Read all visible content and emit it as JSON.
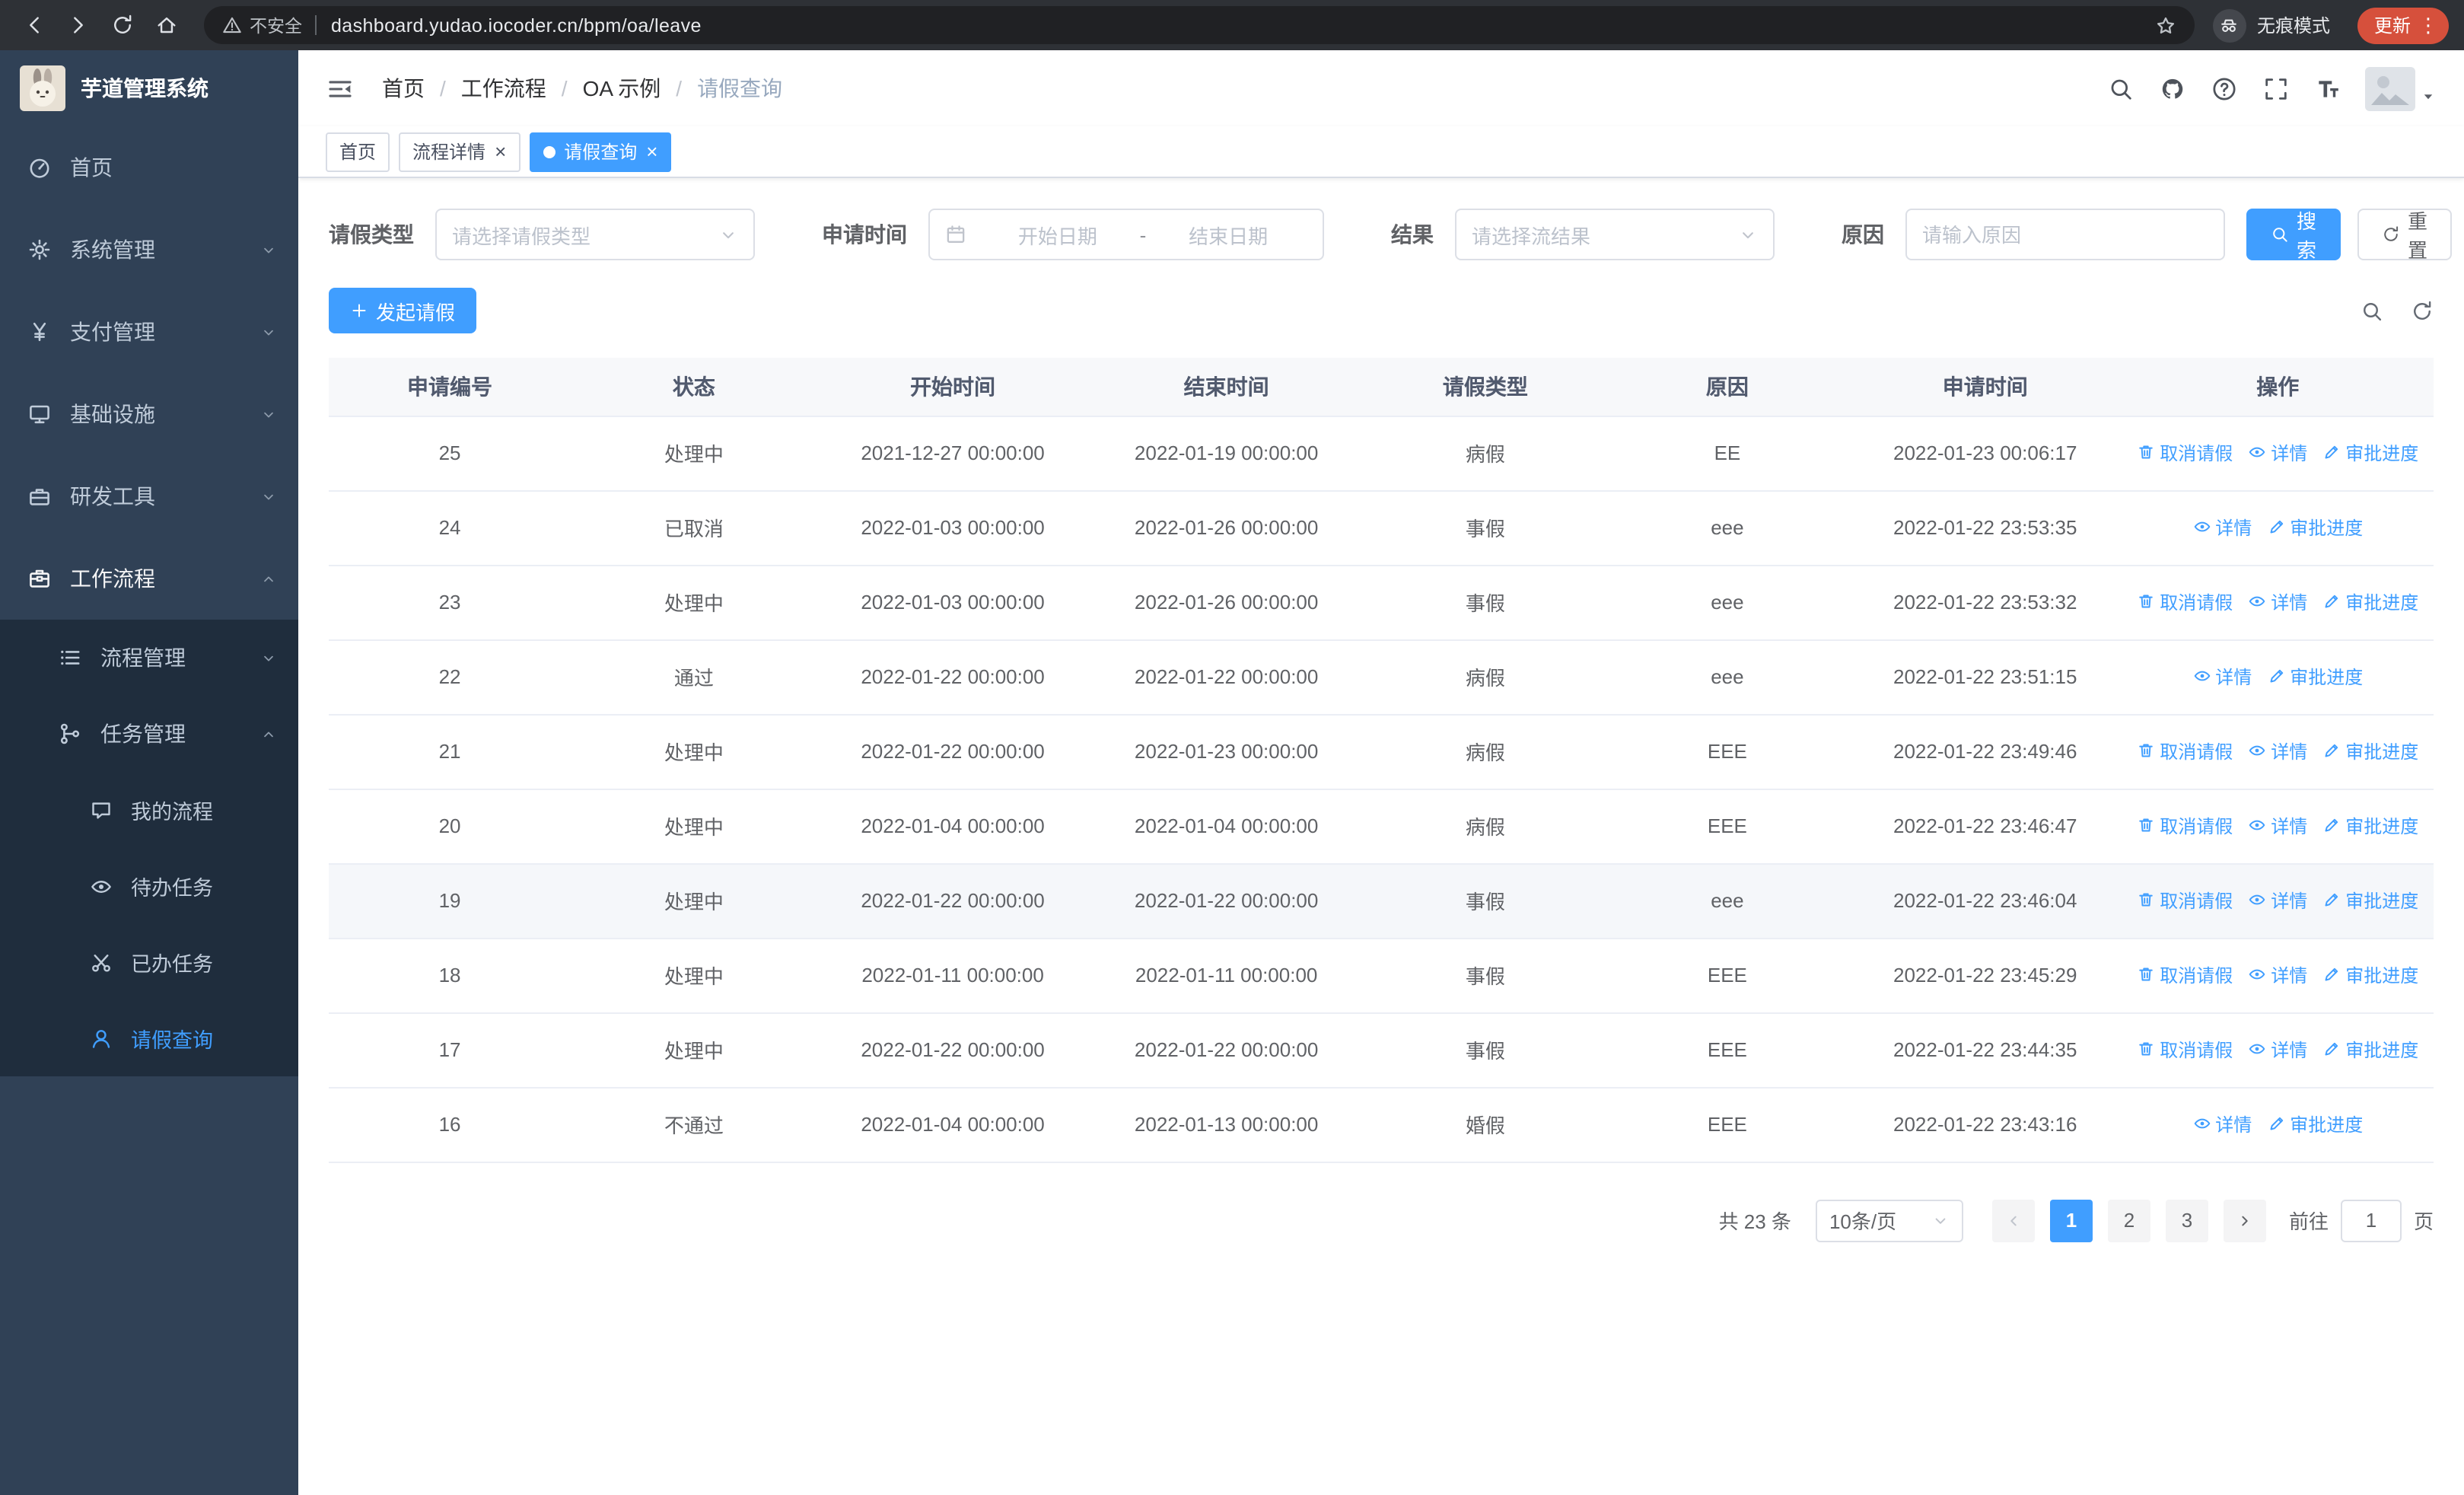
{
  "browser": {
    "security_warning": "不安全",
    "url": "dashboard.yudao.iocoder.cn/bpm/oa/leave",
    "incognito_label": "无痕模式",
    "update_label": "更新"
  },
  "sidebar": {
    "logo_title": "芋道管理系统",
    "items": [
      {
        "key": "home",
        "label": "首页",
        "icon": "dashboard-icon",
        "level": 1
      },
      {
        "key": "system-management",
        "label": "系统管理",
        "icon": "gear-icon",
        "level": 1,
        "chevron": "down"
      },
      {
        "key": "payment-management",
        "label": "支付管理",
        "icon": "yen-icon",
        "level": 1,
        "chevron": "down"
      },
      {
        "key": "infrastructure",
        "label": "基础设施",
        "icon": "monitor-icon",
        "level": 1,
        "chevron": "down"
      },
      {
        "key": "dev-tools",
        "label": "研发工具",
        "icon": "toolbox-icon",
        "level": 1,
        "chevron": "down"
      },
      {
        "key": "workflow",
        "label": "工作流程",
        "icon": "briefcase-icon",
        "level": 1,
        "chevron": "up",
        "expanded": true
      },
      {
        "key": "process-management",
        "label": "流程管理",
        "icon": "list-icon",
        "level": 2,
        "chevron": "down"
      },
      {
        "key": "task-management",
        "label": "任务管理",
        "icon": "branch-icon",
        "level": 2,
        "chevron": "up",
        "expanded": true
      },
      {
        "key": "my-process",
        "label": "我的流程",
        "icon": "chat-icon",
        "level": 3
      },
      {
        "key": "todo-tasks",
        "label": "待办任务",
        "icon": "eye-icon",
        "level": 3
      },
      {
        "key": "done-tasks",
        "label": "已办任务",
        "icon": "scissors-icon",
        "level": 3
      },
      {
        "key": "leave-query",
        "label": "请假查询",
        "icon": "user-icon",
        "level": 3,
        "active": true
      }
    ]
  },
  "header": {
    "breadcrumb": [
      "首页",
      "工作流程",
      "OA 示例",
      "请假查询"
    ],
    "icons": [
      "search-icon",
      "github-icon",
      "help-icon",
      "fullscreen-icon",
      "fontsize-icon"
    ]
  },
  "tabs": [
    {
      "key": "home",
      "label": "首页",
      "active": false,
      "closable": false
    },
    {
      "key": "process-detail",
      "label": "流程详情",
      "active": false,
      "closable": true
    },
    {
      "key": "leave-query",
      "label": "请假查询",
      "active": true,
      "closable": true
    }
  ],
  "filters": {
    "leave_type_label": "请假类型",
    "leave_type_placeholder": "请选择请假类型",
    "apply_time_label": "申请时间",
    "start_date_placeholder": "开始日期",
    "date_separator": "-",
    "end_date_placeholder": "结束日期",
    "result_label": "结果",
    "result_placeholder": "请选择流结果",
    "reason_label": "原因",
    "reason_placeholder": "请输入原因",
    "search_button": "搜索",
    "reset_button": "重置"
  },
  "toolbar": {
    "create_button": "发起请假"
  },
  "table": {
    "headers": [
      "申请编号",
      "状态",
      "开始时间",
      "结束时间",
      "请假类型",
      "原因",
      "申请时间",
      "操作"
    ],
    "action_labels": {
      "cancel": "取消请假",
      "detail": "详情",
      "progress": "审批进度"
    },
    "action_icons": {
      "cancel": "trash-icon",
      "detail": "eye-icon",
      "progress": "edit-icon"
    },
    "rows": [
      {
        "id": "25",
        "status": "处理中",
        "start": "2021-12-27 00:00:00",
        "end": "2022-01-19 00:00:00",
        "type": "病假",
        "reason": "EE",
        "apply_time": "2022-01-23 00:06:17",
        "actions": [
          "cancel",
          "detail",
          "progress"
        ]
      },
      {
        "id": "24",
        "status": "已取消",
        "start": "2022-01-03 00:00:00",
        "end": "2022-01-26 00:00:00",
        "type": "事假",
        "reason": "eee",
        "apply_time": "2022-01-22 23:53:35",
        "actions": [
          "detail",
          "progress"
        ]
      },
      {
        "id": "23",
        "status": "处理中",
        "start": "2022-01-03 00:00:00",
        "end": "2022-01-26 00:00:00",
        "type": "事假",
        "reason": "eee",
        "apply_time": "2022-01-22 23:53:32",
        "actions": [
          "cancel",
          "detail",
          "progress"
        ]
      },
      {
        "id": "22",
        "status": "通过",
        "start": "2022-01-22 00:00:00",
        "end": "2022-01-22 00:00:00",
        "type": "病假",
        "reason": "eee",
        "apply_time": "2022-01-22 23:51:15",
        "actions": [
          "detail",
          "progress"
        ]
      },
      {
        "id": "21",
        "status": "处理中",
        "start": "2022-01-22 00:00:00",
        "end": "2022-01-23 00:00:00",
        "type": "病假",
        "reason": "EEE",
        "apply_time": "2022-01-22 23:49:46",
        "actions": [
          "cancel",
          "detail",
          "progress"
        ]
      },
      {
        "id": "20",
        "status": "处理中",
        "start": "2022-01-04 00:00:00",
        "end": "2022-01-04 00:00:00",
        "type": "病假",
        "reason": "EEE",
        "apply_time": "2022-01-22 23:46:47",
        "actions": [
          "cancel",
          "detail",
          "progress"
        ]
      },
      {
        "id": "19",
        "status": "处理中",
        "start": "2022-01-22 00:00:00",
        "end": "2022-01-22 00:00:00",
        "type": "事假",
        "reason": "eee",
        "apply_time": "2022-01-22 23:46:04",
        "actions": [
          "cancel",
          "detail",
          "progress"
        ],
        "highlighted": true
      },
      {
        "id": "18",
        "status": "处理中",
        "start": "2022-01-11 00:00:00",
        "end": "2022-01-11 00:00:00",
        "type": "事假",
        "reason": "EEE",
        "apply_time": "2022-01-22 23:45:29",
        "actions": [
          "cancel",
          "detail",
          "progress"
        ]
      },
      {
        "id": "17",
        "status": "处理中",
        "start": "2022-01-22 00:00:00",
        "end": "2022-01-22 00:00:00",
        "type": "事假",
        "reason": "EEE",
        "apply_time": "2022-01-22 23:44:35",
        "actions": [
          "cancel",
          "detail",
          "progress"
        ]
      },
      {
        "id": "16",
        "status": "不通过",
        "start": "2022-01-04 00:00:00",
        "end": "2022-01-13 00:00:00",
        "type": "婚假",
        "reason": "EEE",
        "apply_time": "2022-01-22 23:43:16",
        "actions": [
          "detail",
          "progress"
        ]
      }
    ]
  },
  "pagination": {
    "total_text": "共 23 条",
    "page_size_label": "10条/页",
    "pages": [
      "1",
      "2",
      "3"
    ],
    "active_page": "1",
    "goto_label": "前往",
    "goto_value": "1",
    "goto_unit": "页"
  },
  "colors": {
    "primary": "#409eff",
    "sidebar_bg": "#304156",
    "sidebar_sub_bg": "#1f2d3d",
    "update_pill": "#d6503c"
  }
}
